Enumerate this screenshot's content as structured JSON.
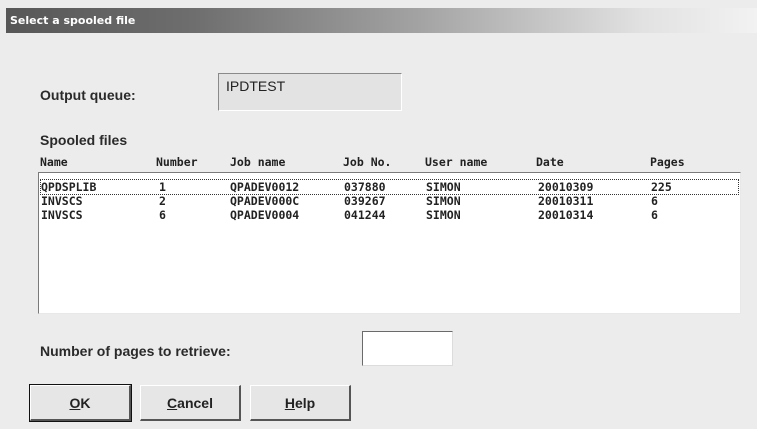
{
  "window": {
    "title": "Select a spooled file"
  },
  "output_queue": {
    "label": "Output queue:",
    "value": "IPDTEST"
  },
  "spooled_files": {
    "label": "Spooled files",
    "columns": [
      "Name",
      "Number",
      "Job name",
      "Job No.",
      "User name",
      "Date",
      "Pages"
    ],
    "rows": [
      {
        "name": "QPDSPLIB",
        "number": "1",
        "job_name": "QPADEV0012",
        "job_no": "037880",
        "user_name": "SIMON",
        "date": "20010309",
        "pages": "225",
        "selected": true
      },
      {
        "name": "INVSCS",
        "number": "2",
        "job_name": "QPADEV000C",
        "job_no": "039267",
        "user_name": "SIMON",
        "date": "20010311",
        "pages": "6",
        "selected": false
      },
      {
        "name": "INVSCS",
        "number": "6",
        "job_name": "QPADEV0004",
        "job_no": "041244",
        "user_name": "SIMON",
        "date": "20010314",
        "pages": "6",
        "selected": false
      }
    ]
  },
  "pages_to_retrieve": {
    "label": "Number of pages to retrieve:",
    "value": ""
  },
  "buttons": {
    "ok": {
      "mnemonic": "O",
      "rest": "K"
    },
    "cancel": {
      "mnemonic": "C",
      "rest": "ancel"
    },
    "help": {
      "mnemonic": "H",
      "rest": "elp"
    }
  }
}
